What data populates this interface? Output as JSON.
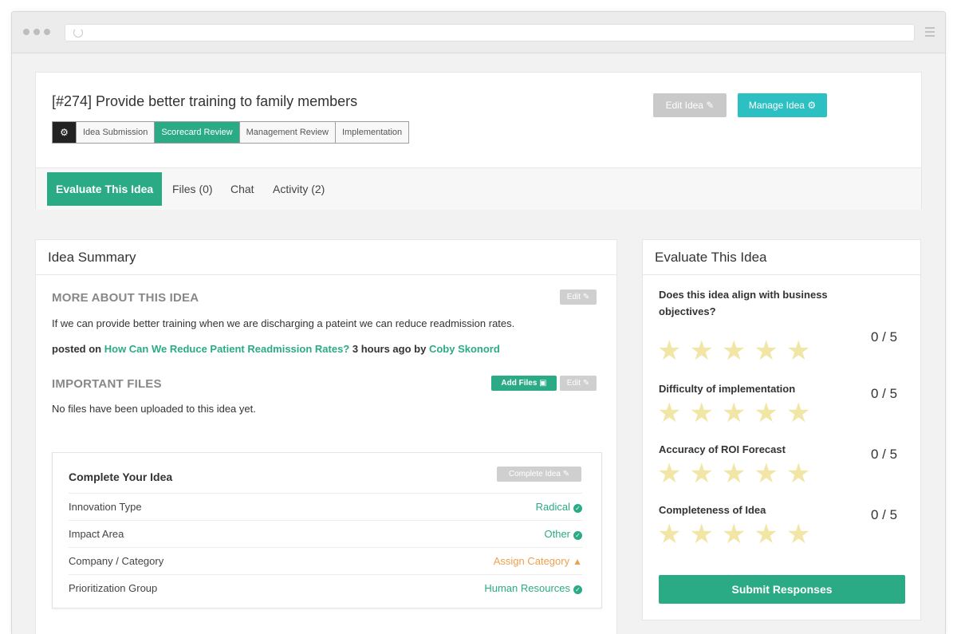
{
  "header": {
    "title": "[#274] Provide better training to family members",
    "stages": [
      "Idea Submission",
      "Scorecard Review",
      "Management Review",
      "Implementation"
    ],
    "active_stage": "Scorecard Review",
    "edit_idea_label": "Edit Idea",
    "manage_idea_label": "Manage Idea"
  },
  "tabs": [
    {
      "label": "Evaluate This Idea"
    },
    {
      "label": "Files (0)"
    },
    {
      "label": "Chat"
    },
    {
      "label": "Activity (2)"
    }
  ],
  "summary": {
    "title": "Idea Summary",
    "more_about_heading": "MORE ABOUT THIS IDEA",
    "edit_label": "Edit",
    "description": "If we can provide better training when we are discharging a pateint we can reduce readmission rates.",
    "posted_prefix": "posted on",
    "posted_link": "How Can We Reduce Patient Readmission Rates?",
    "posted_time": "3 hours ago by",
    "posted_author": "Coby Skonord",
    "files_heading": "IMPORTANT FILES",
    "add_files_label": "Add Files",
    "files_edit_label": "Edit",
    "no_files_text": "No files have been uploaded to this idea yet."
  },
  "complete": {
    "title": "Complete Your Idea",
    "button_label": "Complete Idea",
    "rows": [
      {
        "label": "Innovation Type",
        "value": "Radical"
      },
      {
        "label": "Impact Area",
        "value": "Other"
      },
      {
        "label": "Company / Category",
        "value": "Assign Category"
      },
      {
        "label": "Prioritization Group",
        "value": "Human Resources"
      }
    ]
  },
  "evaluate": {
    "title": "Evaluate This Idea",
    "questions": [
      {
        "text": "Does this idea align with business objectives?",
        "score": "0 / 5",
        "rating": 0
      },
      {
        "text": "Difficulty of implementation",
        "score": "0 / 5",
        "rating": 0
      },
      {
        "text": "Accuracy of ROI Forecast",
        "score": "0 / 5",
        "rating": 0
      },
      {
        "text": "Completeness of Idea",
        "score": "0 / 5",
        "rating": 0
      }
    ],
    "submit_label": "Submit Responses"
  },
  "colors": {
    "accent": "#2bab85",
    "manage": "#2cc0c2",
    "warning": "#f0a04b",
    "star_empty": "#f2e6a6"
  }
}
